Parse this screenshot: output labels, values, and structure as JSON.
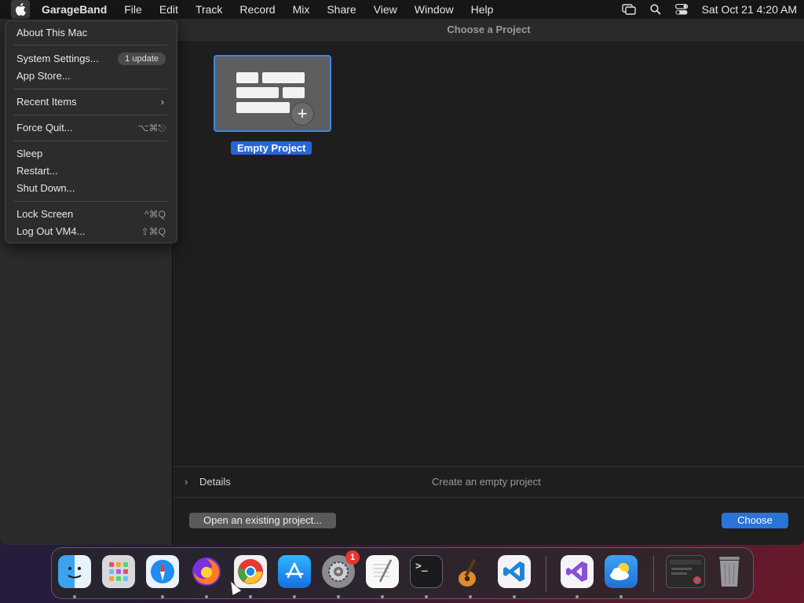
{
  "menubar": {
    "app": "GarageBand",
    "items": [
      "File",
      "Edit",
      "Track",
      "Record",
      "Mix",
      "Share",
      "View",
      "Window",
      "Help"
    ],
    "clock": "Sat Oct 21  4:20 AM"
  },
  "window": {
    "title": "Choose a Project",
    "template": {
      "label": "Empty Project"
    },
    "details": {
      "label": "Details",
      "description": "Create an empty project"
    },
    "buttons": {
      "open": "Open an existing project...",
      "choose": "Choose"
    }
  },
  "apple_menu": {
    "about": "About This Mac",
    "settings": "System Settings...",
    "settings_badge": "1 update",
    "appstore": "App Store...",
    "recent": "Recent Items",
    "forcequit": "Force Quit...",
    "forcequit_sc": "⌥⌘⎋",
    "sleep": "Sleep",
    "restart": "Restart...",
    "shutdown": "Shut Down...",
    "lock": "Lock Screen",
    "lock_sc": "^⌘Q",
    "logout": "Log Out VM4...",
    "logout_sc": "⇧⌘Q"
  },
  "dock": {
    "settings_badge": "1"
  },
  "colors": {
    "accent": "#2a73d9",
    "menu_bg": "#2c2c2e",
    "badge_red": "#e8372c"
  }
}
